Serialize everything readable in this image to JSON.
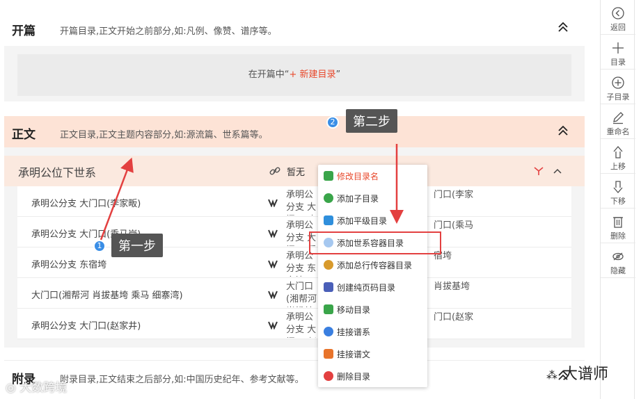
{
  "sections": {
    "opening": {
      "title": "开篇",
      "desc": "开篇目录,正文开始之前部分,如:凡例、像赞、谱序等。",
      "empty_prefix": "在开篇中“",
      "empty_link": "+ 新建目录",
      "empty_suffix": "”"
    },
    "body": {
      "title": "正文",
      "desc": "正文目录,正文主题内容部分,如:源流篇、世系篇等。",
      "volume": {
        "title": "承明公位下世系",
        "status": "暂无"
      },
      "rows": [
        {
          "name": "承明公分支 大门口(李家畈)",
          "val": "承明公分支 大门口(李家畈)",
          "val_tail": "门口(李家"
        },
        {
          "name": "承明公分支 大门口(乘马岗)",
          "val": "承明公分支 大门口(乘马岗)",
          "val_tail": "门口(乘马"
        },
        {
          "name": "承明公分支 东宿垮",
          "val": "承明公分支 东宿垮",
          "val_tail": "宿垮"
        },
        {
          "name": "大门口(湘帮河 肖拔基垮 乘马 细寨湾)",
          "val": "大门口(湘帮河 肖拔基垮 乘马 细寨湾)",
          "val_tail": "肖拔基垮"
        },
        {
          "name": "承明公分支 大门口(赵家井)",
          "val": "承明公分支 大门口(赵家井)",
          "val_tail": "门口(赵家"
        }
      ]
    },
    "appendix": {
      "title": "附录",
      "desc": "附录目录,正文结束之后部分,如:中国历史纪年、参考文献等。"
    }
  },
  "toolbar": [
    {
      "label": "返回",
      "icon": "back-circle-icon"
    },
    {
      "label": "目录",
      "icon": "plus-icon"
    },
    {
      "label": "子目录",
      "icon": "plus-circle-icon"
    },
    {
      "label": "重命名",
      "icon": "pencil-icon"
    },
    {
      "label": "上移",
      "icon": "arrow-up-icon"
    },
    {
      "label": "下移",
      "icon": "arrow-down-icon"
    },
    {
      "label": "删除",
      "icon": "trash-icon"
    },
    {
      "label": "隐藏",
      "icon": "eye-icon"
    }
  ],
  "context_menu": [
    {
      "label": "修改目录名",
      "color": "#3aa54a"
    },
    {
      "label": "添加子目录",
      "color": "#3aa54a"
    },
    {
      "label": "添加平级目录",
      "color": "#2f8fdc"
    },
    {
      "label": "添加世系容器目录",
      "color": "#4f8fe0"
    },
    {
      "label": "添加总行传容器目录",
      "color": "#d89a2c"
    },
    {
      "label": "创建纯页码目录",
      "color": "#4a5fb8"
    },
    {
      "label": "移动目录",
      "color": "#3aa54a"
    },
    {
      "label": "挂接谱系",
      "color": "#3a7fe0"
    },
    {
      "label": "挂接谱文",
      "color": "#e8742b"
    },
    {
      "label": "删除目录",
      "color": "#e34040"
    }
  ],
  "annotations": {
    "step1": "第一步",
    "step1_num": "1",
    "step2": "第二步",
    "step2_num": "2"
  },
  "watermark": {
    "left": "大数跨境",
    "right": "大谱师"
  }
}
